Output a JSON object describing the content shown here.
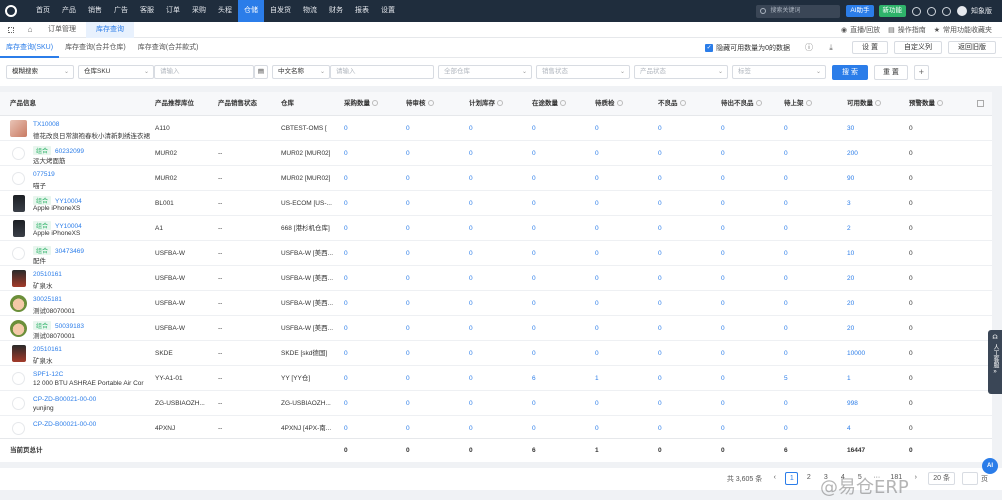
{
  "topnav": {
    "items": [
      "首页",
      "产品",
      "销售",
      "广告",
      "客服",
      "订单",
      "采购",
      "头程",
      "仓储",
      "自发货",
      "物流",
      "财务",
      "报表",
      "设置"
    ],
    "active_index": 8,
    "search_placeholder": "搜索关键词",
    "ai_label": "AI助手",
    "new_label": "新功能",
    "user": "知象版"
  },
  "tabsbar": {
    "tabs": [
      "订单管理",
      "库存查询"
    ],
    "active_index": 1
  },
  "subtabs": {
    "items": [
      "库存查询(SKU)",
      "库存查询(合并仓库)",
      "库存查询(合并款式)"
    ],
    "active_index": 0
  },
  "actions": {
    "hide_zero": "隐藏可用数量为0的数据",
    "settings": "设 置",
    "custom_columns": "自定义列",
    "back_old": "返回旧版"
  },
  "header_links": {
    "video": "直播/回放",
    "guide": "操作指南",
    "favorites": "常用功能收藏夹"
  },
  "filters": {
    "fuzzy": "模糊搜索",
    "sku_type": "仓库SKU",
    "input_ph": "请输入",
    "cn_name": "中文名称",
    "input_ph2": "请输入",
    "warehouse": "全部仓库",
    "sale_status": "销售状态",
    "product_status": "产品状态",
    "mark": "标签",
    "search_btn": "搜 索",
    "reset_btn": "重 置"
  },
  "table": {
    "columns": [
      "产品信息",
      "产品推荐库位",
      "产品销售状态",
      "仓库",
      "采购数量",
      "待审核",
      "计划库存",
      "在途数量",
      "待质检",
      "不良品",
      "待出不良品",
      "待上架",
      "可用数量",
      "预警数量"
    ],
    "rows": [
      {
        "sku": "TX10008",
        "tag": "",
        "name": "德花改良日常旗袍春秋小清新刺绣连衣裙",
        "thumb": "pic",
        "loc": "A110",
        "status": "",
        "wh": "CBTEST-OMS [",
        "v": [
          "0",
          "0",
          "0",
          "0",
          "0",
          "0",
          "0",
          "0",
          "30",
          "0"
        ]
      },
      {
        "sku": "60232099",
        "tag": "组合",
        "name": "远大烤面筋",
        "thumb": "empty",
        "loc": "MUR02",
        "status": "--",
        "wh": "MUR02 [MUR02]",
        "v": [
          "0",
          "0",
          "0",
          "0",
          "0",
          "0",
          "0",
          "0",
          "200",
          "0"
        ]
      },
      {
        "sku": "077519",
        "tag": "",
        "name": "喵子",
        "thumb": "empty",
        "loc": "MUR02",
        "status": "--",
        "wh": "MUR02 [MUR02]",
        "v": [
          "0",
          "0",
          "0",
          "0",
          "0",
          "0",
          "0",
          "0",
          "90",
          "0"
        ]
      },
      {
        "sku": "YY10004",
        "tag": "组合",
        "name": "Apple iPhoneXS",
        "thumb": "phone",
        "loc": "BL001",
        "status": "--",
        "wh": "US-ECOM [US-...",
        "v": [
          "0",
          "0",
          "0",
          "0",
          "0",
          "0",
          "0",
          "0",
          "3",
          "0"
        ]
      },
      {
        "sku": "YY10004",
        "tag": "组合",
        "name": "Apple iPhoneXS",
        "thumb": "phone",
        "loc": "A1",
        "status": "--",
        "wh": "668 [港杉机仓库]",
        "v": [
          "0",
          "0",
          "0",
          "0",
          "0",
          "0",
          "0",
          "0",
          "2",
          "0"
        ]
      },
      {
        "sku": "30473469",
        "tag": "组合",
        "name": "配件",
        "thumb": "empty",
        "loc": "USFBA-W",
        "status": "--",
        "wh": "USFBA-W [美西...",
        "v": [
          "0",
          "0",
          "0",
          "0",
          "0",
          "0",
          "0",
          "0",
          "10",
          "0"
        ]
      },
      {
        "sku": "20510161",
        "tag": "",
        "name": "矿泉水",
        "thumb": "bottle",
        "loc": "USFBA-W",
        "status": "--",
        "wh": "USFBA-W [美西...",
        "v": [
          "0",
          "0",
          "0",
          "0",
          "0",
          "0",
          "0",
          "0",
          "20",
          "0"
        ]
      },
      {
        "sku": "30025181",
        "tag": "",
        "name": "测试08070001",
        "thumb": "face",
        "loc": "USFBA-W",
        "status": "--",
        "wh": "USFBA-W [美西...",
        "v": [
          "0",
          "0",
          "0",
          "0",
          "0",
          "0",
          "0",
          "0",
          "20",
          "0"
        ]
      },
      {
        "sku": "50039183",
        "tag": "组合",
        "name": "测试08070001",
        "thumb": "face",
        "loc": "USFBA-W",
        "status": "--",
        "wh": "USFBA-W [美西...",
        "v": [
          "0",
          "0",
          "0",
          "0",
          "0",
          "0",
          "0",
          "0",
          "20",
          "0"
        ]
      },
      {
        "sku": "20510161",
        "tag": "",
        "name": "矿泉水",
        "thumb": "bottle",
        "loc": "SKDE",
        "status": "--",
        "wh": "SKDE [skd德国]",
        "v": [
          "0",
          "0",
          "0",
          "0",
          "0",
          "0",
          "0",
          "0",
          "10000",
          "0"
        ]
      },
      {
        "sku": "SPF1-12C",
        "tag": "",
        "name": "12 000 BTU ASHRAE Portable Air Cor",
        "thumb": "empty",
        "loc": "YY-A1-01",
        "status": "--",
        "wh": "YY [YY仓]",
        "v": [
          "0",
          "0",
          "0",
          "6",
          "1",
          "0",
          "0",
          "5",
          "1",
          "0"
        ]
      },
      {
        "sku": "CP-ZD-B00021-00-00",
        "tag": "",
        "name": "yunjing",
        "thumb": "empty",
        "loc": "ZG-USBIAOZH...",
        "status": "--",
        "wh": "ZG-USBIAOZH...",
        "v": [
          "0",
          "0",
          "0",
          "0",
          "0",
          "0",
          "0",
          "0",
          "998",
          "0"
        ]
      },
      {
        "sku": "CP-ZD-B00021-00-00",
        "tag": "",
        "name": "",
        "thumb": "empty",
        "loc": "4PXNJ",
        "status": "--",
        "wh": "4PXNJ [4PX-南...",
        "v": [
          "0",
          "0",
          "0",
          "0",
          "0",
          "0",
          "0",
          "0",
          "4",
          "0"
        ]
      }
    ],
    "totals_label": "当前页总计",
    "totals": [
      "0",
      "0",
      "0",
      "6",
      "1",
      "0",
      "0",
      "6",
      "16447",
      "0"
    ]
  },
  "pager": {
    "total": "共 3,605 条",
    "pages": [
      "1",
      "2",
      "3",
      "4",
      "5"
    ],
    "active": "1",
    "last": "181",
    "page_size": "20 条",
    "goto_suffix": "页"
  },
  "watermark": "@易仓ERP",
  "sidetool": "人工客服",
  "ai_float": "AI"
}
